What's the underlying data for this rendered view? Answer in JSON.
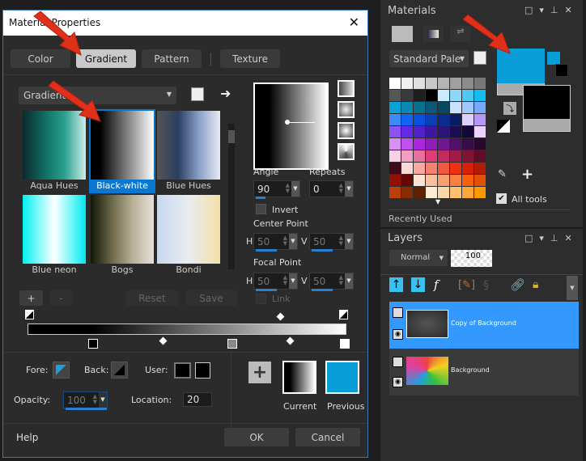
{
  "dialog": {
    "title": "Material Properties",
    "close": "✕",
    "tabs": [
      {
        "label": "Color"
      },
      {
        "label": "Gradient",
        "selected": true
      },
      {
        "label": "Pattern"
      },
      {
        "label": "Texture"
      }
    ],
    "gradient_dropdown": "Gradients",
    "gradients": [
      {
        "name": "Aqua Hues",
        "css": "linear-gradient(90deg,#0c2a2c,#0f6a60,#2aa090,#cfeee8)"
      },
      {
        "name": "Black-white",
        "css": "linear-gradient(90deg,#000 15%,#fff)",
        "selected": true
      },
      {
        "name": "Blue Hues",
        "css": "linear-gradient(90deg,#555,#2b3f60,#8aa0c8,#e8eaf4)"
      },
      {
        "name": "Blue neon",
        "css": "linear-gradient(90deg,#00f0f0,#7ff8f8,#fff 50%,#7ff8f8,#00e8f0)"
      },
      {
        "name": "Bogs",
        "css": "linear-gradient(90deg,#101808,#6a6848,#b8b098,#e8e0d8)"
      },
      {
        "name": "Bondi",
        "css": "linear-gradient(90deg,#c8d8f0,#e8ecf0,#f4e0a8)"
      }
    ],
    "buttons": {
      "add": "+",
      "remove": "-",
      "reset": "Reset",
      "save": "Save",
      "ok": "OK",
      "cancel": "Cancel",
      "help": "Help"
    },
    "angle": {
      "label": "Angle",
      "value": "90"
    },
    "repeats": {
      "label": "Repeats",
      "value": "0"
    },
    "invert": "Invert",
    "center_point": {
      "label": "Center Point",
      "h": "50",
      "v": "50"
    },
    "focal_point": {
      "label": "Focal Point",
      "h": "50",
      "v": "50"
    },
    "h_label": "H",
    "v_label": "V",
    "link": "Link",
    "fore": "Fore:",
    "back": "Back:",
    "user": "User:",
    "opacity": {
      "label": "Opacity:",
      "value": "100"
    },
    "location": {
      "label": "Location:",
      "value": "20"
    },
    "current": "Current",
    "previous": "Previous",
    "previous_color": "#0a9ed8"
  },
  "materials": {
    "title": "Materials",
    "palette_dropdown": "Standard Pale",
    "all_tools": "All tools",
    "all_tools_checked": true,
    "recently_used": "Recently Used",
    "foreground": "#0a9ed8",
    "background": "#000000",
    "palette": [
      [
        "#ffffff",
        "#f0f0f0",
        "#e0e0e0",
        "#c8c8c8",
        "#b4b4b4",
        "#a0a0a0",
        "#8c8c8c",
        "#787878"
      ],
      [
        "#555555",
        "#3a3a3a",
        "#1e1e1e",
        "#000000",
        "#c8ecfc",
        "#8cd8f8",
        "#50c8f4",
        "#14bcf0"
      ],
      [
        "#0aa0d8",
        "#0a88b4",
        "#0a7090",
        "#0a5878",
        "#084860",
        "#c8e0fc",
        "#a0c8fc",
        "#78a8fc"
      ],
      [
        "#3c8cf8",
        "#1464f4",
        "#0a50dc",
        "#0a40b4",
        "#0a2c8c",
        "#0a1c64",
        "#dcd0fc",
        "#b498f8"
      ],
      [
        "#8c50f4",
        "#6428e8",
        "#5020c8",
        "#3c18a0",
        "#2c1478",
        "#1e0c50",
        "#140838",
        "#f0d0fc"
      ],
      [
        "#d890f4",
        "#c050f0",
        "#a828dc",
        "#8c20b4",
        "#701890",
        "#501068",
        "#380c48",
        "#28082c"
      ],
      [
        "#f8d0e4",
        "#f0a0c0",
        "#e8709c",
        "#e03c78",
        "#c02c60",
        "#a01c48",
        "#801434",
        "#600c24"
      ],
      [
        "#400818",
        "#fcd8d8",
        "#f8a8a0",
        "#f48070",
        "#f05840",
        "#f03010",
        "#d82008",
        "#b01c04"
      ],
      [
        "#901004",
        "#680804",
        "#fce4d4",
        "#f8c0a0",
        "#f8a070",
        "#f88040",
        "#f86010",
        "#e05008"
      ],
      [
        "#b84008",
        "#882c04",
        "#602004",
        "#fcecd4",
        "#fcd8a8",
        "#fcc070",
        "#fca838",
        "#fc9800"
      ]
    ]
  },
  "layers": {
    "title": "Layers",
    "blend_mode": "Normal",
    "opacity": "100",
    "items": [
      {
        "name": "Copy of Background",
        "selected": true
      },
      {
        "name": "Background"
      }
    ]
  },
  "accent": "#3399ff",
  "annotation_color": "#e0301a"
}
